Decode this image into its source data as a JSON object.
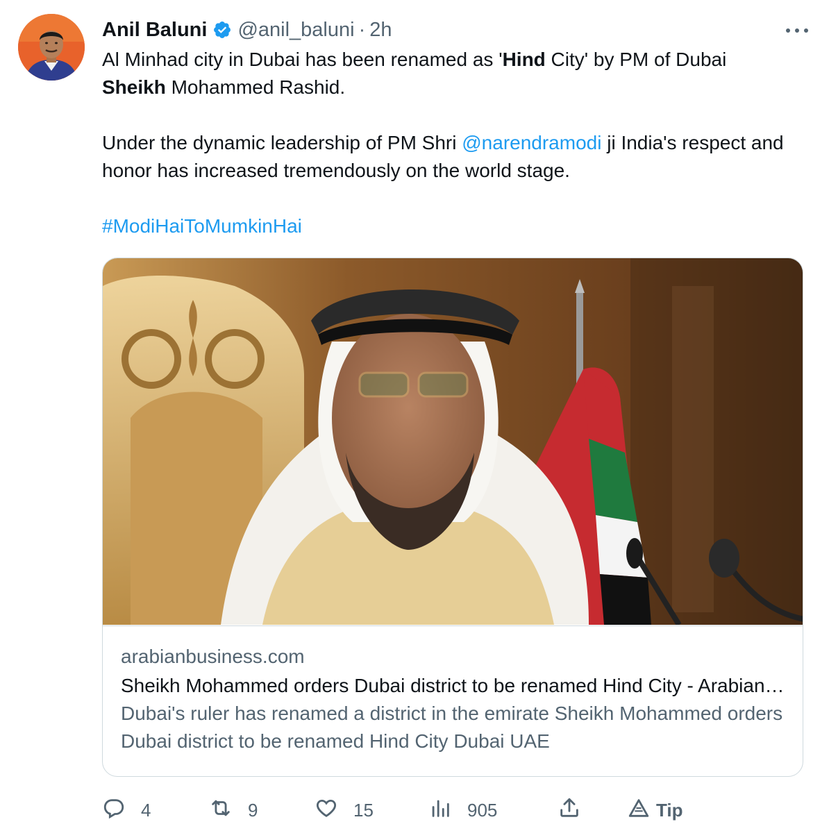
{
  "author": {
    "display_name": "Anil Baluni",
    "handle": "@anil_baluni",
    "separator": "·",
    "time": "2h"
  },
  "tweet": {
    "line1_pre": "Al Minhad city in Dubai has been renamed as '",
    "line1_bold": "Hind",
    "line1_post": " City' by PM of Dubai",
    "line2_bold": "Sheikh",
    "line2_post": " Mohammed Rashid.",
    "para2_pre": "Under the dynamic leadership of PM Shri ",
    "mention": "@narendramodi",
    "para2_post": " ji India's respect and honor has increased tremendously on the world stage.",
    "hashtag": "#ModiHaiToMumkinHai"
  },
  "card": {
    "domain": "arabianbusiness.com",
    "title": "Sheikh Mohammed orders Dubai district to be renamed Hind City - Arabian Business",
    "description": "Dubai's ruler has renamed a district in the emirate Sheikh Mohammed orders Dubai district to be renamed Hind City Dubai UAE"
  },
  "actions": {
    "replies": "4",
    "retweets": "9",
    "likes": "15",
    "views": "905",
    "tip_label": "Tip"
  },
  "icons": {
    "verified": "verified-badge-icon",
    "more": "more-options-icon",
    "reply": "reply-icon",
    "retweet": "retweet-icon",
    "like": "heart-icon",
    "views": "views-icon",
    "share": "share-icon",
    "tip": "tip-icon"
  },
  "colors": {
    "accent": "#1d9bf0",
    "secondary_text": "#536471",
    "border": "#cfd9de"
  }
}
